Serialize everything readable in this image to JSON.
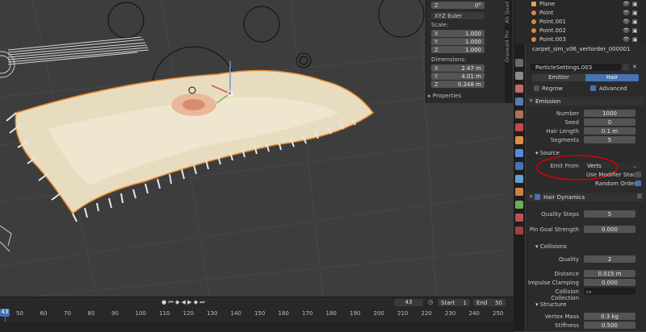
{
  "npanel": {
    "z_top": {
      "k": "Z",
      "v": "0°"
    },
    "rotation_mode": "XYZ Euler",
    "scale_label": "Scale:",
    "scale": [
      {
        "k": "X",
        "v": "1.000"
      },
      {
        "k": "Y",
        "v": "1.000"
      },
      {
        "k": "Z",
        "v": "1.000"
      }
    ],
    "dimensions_label": "Dimensions:",
    "dimensions": [
      {
        "k": "X",
        "v": "2.47 m"
      },
      {
        "k": "Y",
        "v": "4.01 m"
      },
      {
        "k": "Z",
        "v": "0.248 m"
      }
    ],
    "properties_label": "Properties",
    "tabs": [
      "Quad",
      "Als",
      "Graswald Pro"
    ]
  },
  "outliner": {
    "rows": [
      {
        "name": "Plane"
      },
      {
        "name": "Point"
      },
      {
        "name": "Point.001"
      },
      {
        "name": "Point.002"
      },
      {
        "name": "Point.003"
      }
    ]
  },
  "properties": {
    "object_name": "carpet_sim_v06_vertorder_000001",
    "particle_settings": "ParticleSettings.003",
    "type_emitter": "Emitter",
    "type_hair": "Hair",
    "regrow": "Regrow",
    "advanced": "Advanced",
    "emission": {
      "title": "Emission",
      "number_label": "Number",
      "number": "1000",
      "seed_label": "Seed",
      "seed": "0",
      "hair_length_label": "Hair Length",
      "hair_length": "0.1 m",
      "segments_label": "Segments",
      "segments": "5"
    },
    "source": {
      "title": "Source",
      "emit_from_label": "Emit From",
      "emit_from": "Verts",
      "use_modifier_stack": "Use Modifier Stack",
      "random_order": "Random Order"
    },
    "hair_dynamics": {
      "title": "Hair Dynamics",
      "quality_steps_label": "Quality Steps",
      "quality_steps": "5",
      "pin_goal_label": "Pin Goal Strength",
      "pin_goal": "0.000"
    },
    "collisions": {
      "title": "Collisions",
      "quality_label": "Quality",
      "quality": "2",
      "distance_label": "Distance",
      "distance": "0.015 m",
      "impulse_label": "Impulse Clamping",
      "impulse": "0.000",
      "collection_label": "Collision Collection"
    },
    "structure": {
      "title": "Structure",
      "vertex_mass_label": "Vertex Mass",
      "vertex_mass": "0.3 kg",
      "stiffness_label": "Stiffness",
      "stiffness": "0.500"
    }
  },
  "timeline": {
    "current_frame_badge": "43",
    "frame_field": "43",
    "start_label": "Start",
    "start": "1",
    "end_label": "End",
    "end": "50",
    "ticks": [
      "50",
      "60",
      "70",
      "80",
      "90",
      "100",
      "110",
      "120",
      "130",
      "140",
      "150",
      "160",
      "170",
      "180",
      "190",
      "200",
      "210",
      "220",
      "230",
      "240",
      "250"
    ]
  },
  "colors": {
    "accent": "#4772b3",
    "annotation": "#d40000",
    "object_outline": "#e8882a"
  }
}
